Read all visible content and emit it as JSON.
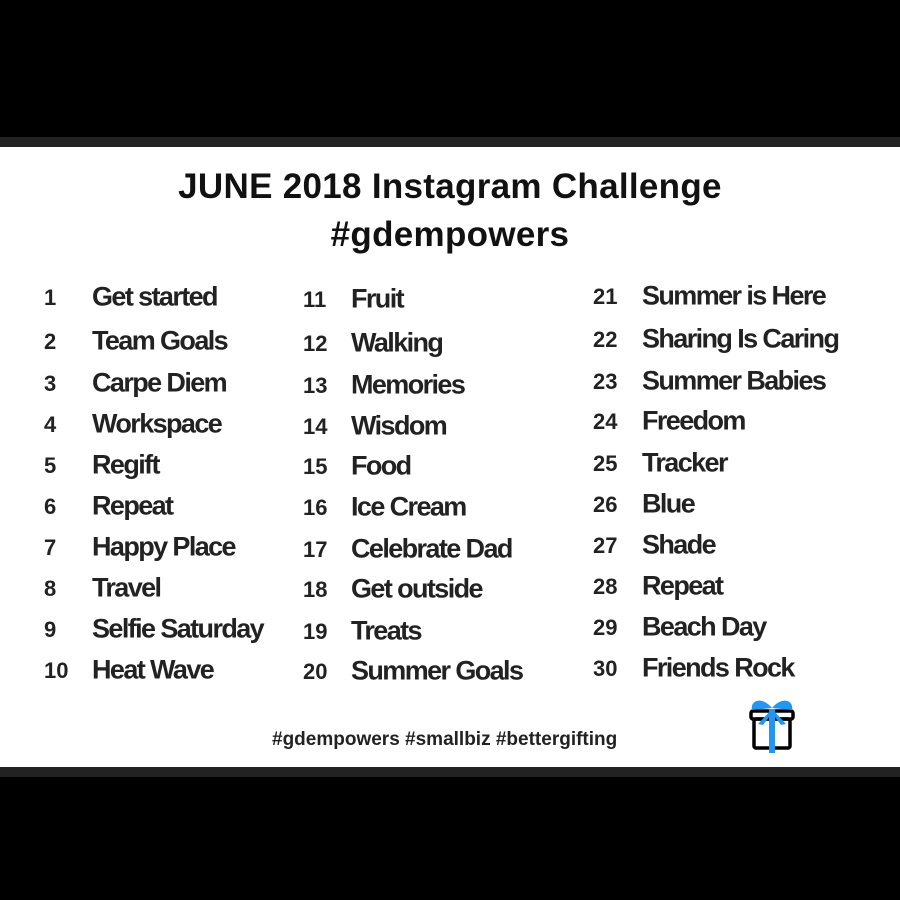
{
  "title_line1": "JUNE 2018 Instagram Challenge",
  "title_line2": "#gdempowers",
  "days": [
    {
      "n": "1",
      "label": "Get started"
    },
    {
      "n": "2",
      "label": "Team Goals"
    },
    {
      "n": "3",
      "label": "Carpe Diem"
    },
    {
      "n": "4",
      "label": "Workspace"
    },
    {
      "n": "5",
      "label": "Regift"
    },
    {
      "n": "6",
      "label": "Repeat"
    },
    {
      "n": "7",
      "label": "Happy Place"
    },
    {
      "n": "8",
      "label": "Travel"
    },
    {
      "n": "9",
      "label": "Selfie Saturday"
    },
    {
      "n": "10",
      "label": "Heat Wave"
    },
    {
      "n": "11",
      "label": "Fruit"
    },
    {
      "n": "12",
      "label": "Walking"
    },
    {
      "n": "13",
      "label": "Memories"
    },
    {
      "n": "14",
      "label": "Wisdom"
    },
    {
      "n": "15",
      "label": "Food"
    },
    {
      "n": "16",
      "label": "Ice Cream"
    },
    {
      "n": "17",
      "label": "Celebrate Dad"
    },
    {
      "n": "18",
      "label": "Get outside"
    },
    {
      "n": "19",
      "label": "Treats"
    },
    {
      "n": "20",
      "label": "Summer Goals"
    },
    {
      "n": "21",
      "label": "Summer is Here"
    },
    {
      "n": "22",
      "label": "Sharing Is Caring"
    },
    {
      "n": "23",
      "label": "Summer Babies"
    },
    {
      "n": "24",
      "label": "Freedom"
    },
    {
      "n": "25",
      "label": "Tracker"
    },
    {
      "n": "26",
      "label": "Blue"
    },
    {
      "n": "27",
      "label": "Shade"
    },
    {
      "n": "28",
      "label": "Repeat"
    },
    {
      "n": "29",
      "label": "Beach Day"
    },
    {
      "n": "30",
      "label": "Friends Rock"
    }
  ],
  "hashtags": "#gdempowers #smallbiz #bettergifting",
  "icon": "gift-icon",
  "colors": {
    "accent": "#2196f3",
    "text": "#222222"
  }
}
